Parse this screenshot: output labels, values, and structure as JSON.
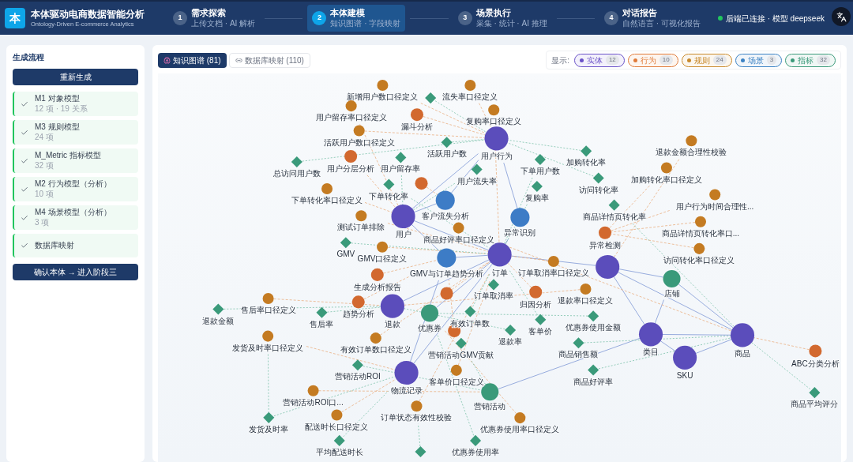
{
  "app": {
    "logo": "本",
    "title": "本体驱动电商数据智能分析",
    "subtitle": "Ontology-Driven E-commerce Analytics"
  },
  "steps": [
    {
      "number": "1",
      "title": "需求探索",
      "subtitle": "上传文档 · AI 解析",
      "selected": false
    },
    {
      "number": "2",
      "title": "本体建模",
      "subtitle": "知识图谱 · 字段映射",
      "selected": true
    },
    {
      "number": "3",
      "title": "场景执行",
      "subtitle": "采集 · 统计 · AI 推理",
      "selected": false
    },
    {
      "number": "4",
      "title": "对话报告",
      "subtitle": "自然语言 · 可视化报告",
      "selected": false
    }
  ],
  "status": {
    "text": "后端已连接 · 模型 deepseek",
    "connected": true
  },
  "sidebar": {
    "title": "生成流程",
    "regenerate_button": "重新生成",
    "items": [
      {
        "title": "M1 对象模型",
        "meta": "12 项 · 19 关系",
        "done": true
      },
      {
        "title": "M3 规则模型",
        "meta": "24 项",
        "done": true
      },
      {
        "title": "M_Metric 指标模型",
        "meta": "32 项",
        "done": true
      },
      {
        "title": "M2 行为模型（分析）",
        "meta": "10 项",
        "done": true
      },
      {
        "title": "M4 场景模型（分析）",
        "meta": "3 项",
        "done": true
      },
      {
        "title": "数据库映射",
        "done": true
      }
    ],
    "confirm_button": "确认本体 → 进入阶段三"
  },
  "view_tabs": [
    {
      "label": "知识图谱 (81)",
      "kind": "graph",
      "selected": true
    },
    {
      "label": "数据库映射 (110)",
      "kind": "mapping",
      "selected": false
    }
  ],
  "legend": {
    "label": "显示:",
    "items": [
      {
        "label": "实体",
        "count": "12",
        "color": "#6a52c8",
        "on": true
      },
      {
        "label": "行为",
        "count": "10",
        "color": "#e07b39",
        "on": true
      },
      {
        "label": "规则",
        "count": "24",
        "color": "#c98a2c",
        "on": true
      },
      {
        "label": "场景",
        "count": "3",
        "color": "#3b82c4",
        "on": true
      },
      {
        "label": "指标",
        "count": "32",
        "color": "#3a9a7a",
        "on": true
      }
    ]
  },
  "graph": {
    "nodes": [
      {
        "kind": "entity",
        "label": "用户行为"
      },
      {
        "kind": "entity",
        "label": "用户"
      },
      {
        "kind": "entity",
        "label": "订单"
      },
      {
        "kind": "entity"
      },
      {
        "kind": "entity",
        "label": "退款"
      },
      {
        "kind": "entity",
        "label": "物流记录"
      },
      {
        "kind": "entity",
        "label": "类目"
      },
      {
        "kind": "entity",
        "label": "商品"
      },
      {
        "kind": "entity",
        "label": "SKU"
      },
      {
        "kind": "object",
        "label": "店铺"
      },
      {
        "kind": "object",
        "label": "优惠券"
      },
      {
        "kind": "object",
        "label": "营销活动"
      },
      {
        "kind": "scenario",
        "label": "客户流失分析"
      },
      {
        "kind": "scenario",
        "label": "异常识别"
      },
      {
        "kind": "behavior",
        "label": "漏斗分析"
      },
      {
        "kind": "scenario",
        "label": "GMV与订单趋势分析"
      },
      {
        "kind": "behavior",
        "label": "用户分层分析"
      },
      {
        "kind": "behavior"
      },
      {
        "kind": "behavior",
        "label": "异常检测"
      },
      {
        "kind": "behavior",
        "label": "生成分析报告"
      },
      {
        "kind": "behavior",
        "label": "趋势分析"
      },
      {
        "kind": "behavior",
        "label": "归因分析"
      },
      {
        "kind": "behavior"
      },
      {
        "kind": "behavior"
      },
      {
        "kind": "behavior",
        "label": "ABC分类分析"
      },
      {
        "kind": "rule",
        "label": "新增用户数口径定义"
      },
      {
        "kind": "rule",
        "label": "用户留存率口径定义"
      },
      {
        "kind": "rule",
        "label": "活跃用户数口径定义"
      },
      {
        "kind": "rule",
        "label": "流失率口径定义"
      },
      {
        "kind": "rule",
        "label": "复购率口径定义"
      },
      {
        "kind": "rule",
        "label": "下单转化率口径定义"
      },
      {
        "kind": "rule",
        "label": "退款金额合理性校验"
      },
      {
        "kind": "rule",
        "label": "加购转化率口径定义"
      },
      {
        "kind": "rule",
        "label": "用户行为时间合理性..."
      },
      {
        "kind": "rule",
        "label": "商品详情页转化率口..."
      },
      {
        "kind": "rule",
        "label": "访问转化率口径定义"
      },
      {
        "kind": "rule",
        "label": "测试订单排除"
      },
      {
        "kind": "rule",
        "label": "GMV口径定义"
      },
      {
        "kind": "rule",
        "label": "商品好评率口径定义"
      },
      {
        "kind": "rule",
        "label": "订单取消率口径定义"
      },
      {
        "kind": "rule",
        "label": "售后率口径定义"
      },
      {
        "kind": "rule",
        "label": "发货及时率口径定义"
      },
      {
        "kind": "rule",
        "label": "营销活动ROI口..."
      },
      {
        "kind": "rule",
        "label": "配送时长口径定义"
      },
      {
        "kind": "rule",
        "label": "订单状态有效性校验"
      },
      {
        "kind": "rule",
        "label": "有效订单数口径定义"
      },
      {
        "kind": "rule",
        "label": "客单价口径定义"
      },
      {
        "kind": "rule",
        "label": "优惠券使用率口径定义"
      },
      {
        "kind": "rule",
        "label": "退款率口径定义"
      },
      {
        "kind": "metric"
      },
      {
        "kind": "metric",
        "label": "用户留存率"
      },
      {
        "kind": "metric",
        "label": "活跃用户数"
      },
      {
        "kind": "metric",
        "label": "用户流失率"
      },
      {
        "kind": "metric",
        "label": "下单用户数"
      },
      {
        "kind": "metric",
        "label": "加购转化率"
      },
      {
        "kind": "metric",
        "label": "总访问用户数"
      },
      {
        "kind": "metric",
        "label": "下单转化率"
      },
      {
        "kind": "metric",
        "label": "复购率"
      },
      {
        "kind": "metric",
        "label": "访问转化率"
      },
      {
        "kind": "metric",
        "label": "商品详情页转化率"
      },
      {
        "kind": "metric",
        "label": "GMV"
      },
      {
        "kind": "metric",
        "label": "退款金额"
      },
      {
        "kind": "metric",
        "label": "售后率"
      },
      {
        "kind": "metric",
        "label": "营销活动ROI"
      },
      {
        "kind": "metric",
        "label": "有效订单数"
      },
      {
        "kind": "metric",
        "label": "订单取消率"
      },
      {
        "kind": "metric",
        "label": "客单价"
      },
      {
        "kind": "metric",
        "label": "退款率"
      },
      {
        "kind": "metric",
        "label": "营销活动GMV贡献"
      },
      {
        "kind": "metric",
        "label": "优惠券使用金额"
      },
      {
        "kind": "metric",
        "label": "商品销售额"
      },
      {
        "kind": "metric",
        "label": "商品好评率"
      },
      {
        "kind": "metric",
        "label": "发货及时率"
      },
      {
        "kind": "metric",
        "label": "平均配送时长"
      },
      {
        "kind": "metric",
        "label": "优惠券使用率"
      },
      {
        "kind": "metric"
      },
      {
        "kind": "metric",
        "label": "商品平均评分"
      }
    ]
  }
}
